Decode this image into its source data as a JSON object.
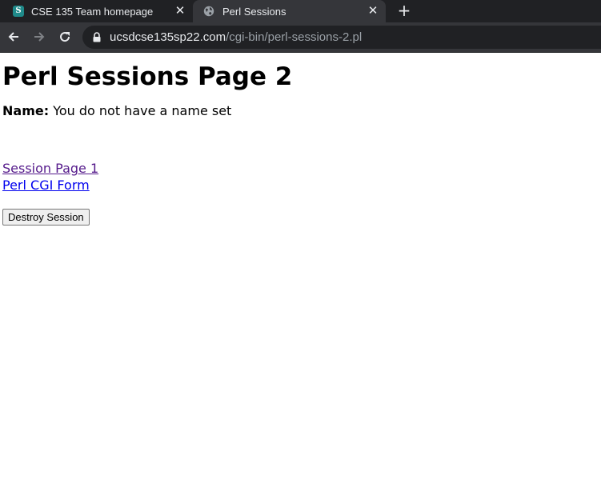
{
  "browser": {
    "tabs": [
      {
        "title": "CSE 135 Team homepage",
        "icon": "s-logo-icon",
        "active": false
      },
      {
        "title": "Perl Sessions",
        "icon": "globe-icon",
        "active": true
      }
    ],
    "close_glyph": "✕",
    "new_tab_glyph": "+",
    "url_host": "ucsdcse135sp22.com",
    "url_path": "/cgi-bin/perl-sessions-2.pl"
  },
  "page": {
    "heading": "Perl Sessions Page 2",
    "name_label": "Name:",
    "name_value": " You do not have a name set",
    "links": [
      {
        "label": "Session Page 1",
        "visited": true
      },
      {
        "label": "Perl CGI Form",
        "visited": false
      }
    ],
    "destroy_button": "Destroy Session"
  },
  "colors": {
    "chrome_dark": "#202124",
    "chrome_active": "#35363a",
    "link_visited": "#551a8b",
    "link": "#0000ee"
  }
}
